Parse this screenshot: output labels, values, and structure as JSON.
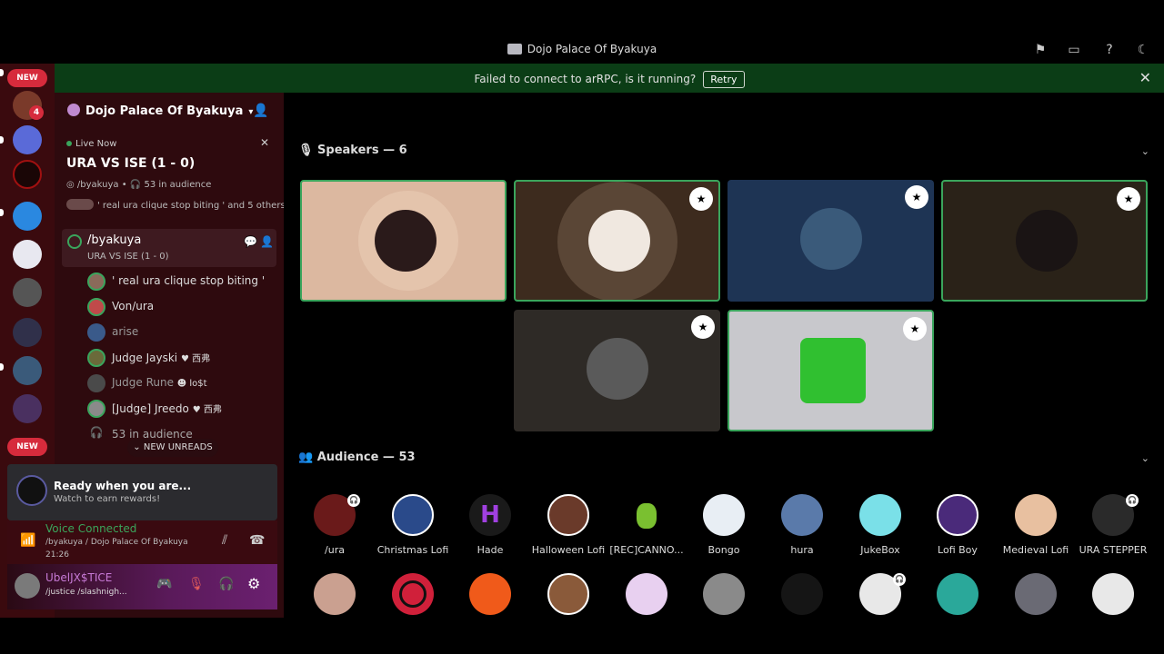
{
  "window": {
    "title": "Dojo Palace Of Byakuya"
  },
  "banner": {
    "message": "Failed to connect to arRPC, is it running?",
    "retry_label": "Retry"
  },
  "rail": {
    "new_label": "NEW",
    "badge_count": "4"
  },
  "sidebar": {
    "server_name": "Dojo Palace Of Byakuya",
    "live_now_label": "Live Now",
    "stage_title": "URA VS ISE (1 - 0)",
    "stage_host": "/byakuya",
    "audience_count_text": "53 in audience",
    "stage_topic_line": "' real ura clique stop biting ' and 5 others",
    "channel_name": "/byakuya",
    "channel_topic": "URA VS ISE (1 - 0)",
    "members": [
      {
        "name": "' real ura clique stop biting '",
        "tag": "",
        "muted": false
      },
      {
        "name": "Von/ura",
        "tag": "",
        "muted": false
      },
      {
        "name": "arise",
        "tag": "",
        "muted": true
      },
      {
        "name": "Judge Jayski",
        "tag": "西弗",
        "muted": false
      },
      {
        "name": "Judge Rune",
        "tag": "lo$t",
        "muted": true
      },
      {
        "name": "[Judge] Jreedo",
        "tag": "西弗",
        "muted": false
      }
    ],
    "audience_line": "53 in audience",
    "new_unreads_label": "NEW UNREADS"
  },
  "promo": {
    "title": "Ready when you are...",
    "subtitle": "Watch to earn rewards!"
  },
  "voice": {
    "status": "Voice Connected",
    "location": "/byakuya / Dojo Palace Of Byakuya",
    "time": "21:26"
  },
  "user": {
    "name": "UbelJX$TICE",
    "status": "/justice /slashnigh..."
  },
  "main": {
    "speakers_label": "Speakers — 6",
    "audience_label": "Audience — 53",
    "audience_row1": [
      "/ura",
      "Christmas Lofi",
      "Hade",
      "Halloween Lofi",
      "[REC]CANNO...",
      "Bongo",
      "hura",
      "JukeBox",
      "Lofi Boy",
      "Medieval Lofi",
      "URA STEPPER"
    ]
  },
  "colors": {
    "speaking_border": "#3aa55c",
    "banner_bg": "#0b3d16",
    "sidebar_bg": "#2e0a0e",
    "new_pill": "#d62b3c"
  }
}
